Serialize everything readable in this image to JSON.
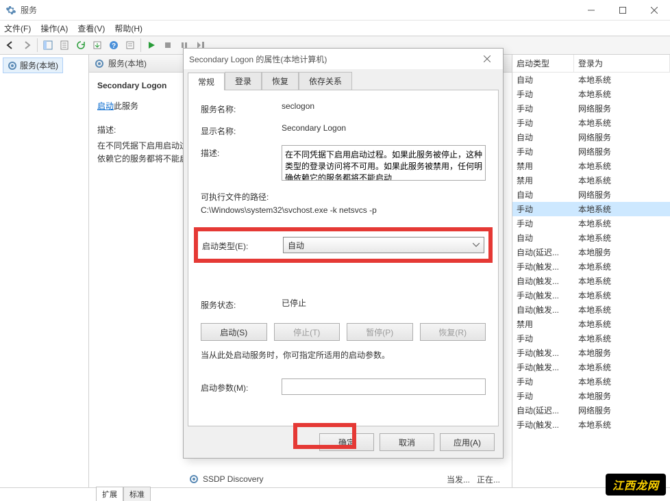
{
  "window": {
    "title": "服务"
  },
  "menu": {
    "file": "文件(F)",
    "action": "操作(A)",
    "view": "查看(V)",
    "help": "帮助(H)"
  },
  "left": {
    "tree_label": "服务(本地)"
  },
  "mid": {
    "header": "服务(本地)",
    "selected_service": "Secondary Logon",
    "start_link": "启动",
    "start_suffix": "此服务",
    "desc_label": "描述:",
    "desc_text": "在不同凭据下启用启动过程。如果此服务被停止，这种类型的登录访问将不可用。如果此服务被禁用，任何明确依赖它的服务都将不能启动"
  },
  "tabs": {
    "ext": "扩展",
    "std": "标准"
  },
  "status": {
    "name": "SSDP Discovery",
    "col3": "当发...",
    "col4": "正在..."
  },
  "cols": {
    "startup": "启动类型",
    "logon": "登录为"
  },
  "rows": [
    {
      "s": "自动",
      "l": "本地系统"
    },
    {
      "s": "手动",
      "l": "本地系统"
    },
    {
      "s": "手动",
      "l": "网络服务"
    },
    {
      "s": "手动",
      "l": "本地系统"
    },
    {
      "s": "自动",
      "l": "网络服务"
    },
    {
      "s": "手动",
      "l": "网络服务"
    },
    {
      "s": "禁用",
      "l": "本地系统"
    },
    {
      "s": "禁用",
      "l": "本地系统"
    },
    {
      "s": "自动",
      "l": "网络服务"
    },
    {
      "s": "手动",
      "l": "本地系统",
      "sel": true
    },
    {
      "s": "手动",
      "l": "本地系统"
    },
    {
      "s": "自动",
      "l": "本地系统"
    },
    {
      "s": "自动(延迟...",
      "l": "本地服务"
    },
    {
      "s": "手动(触发...",
      "l": "本地系统"
    },
    {
      "s": "自动(触发...",
      "l": "本地系统"
    },
    {
      "s": "手动(触发...",
      "l": "本地系统"
    },
    {
      "s": "自动(触发...",
      "l": "本地系统"
    },
    {
      "s": "禁用",
      "l": "本地系统"
    },
    {
      "s": "手动",
      "l": "本地系统"
    },
    {
      "s": "手动(触发...",
      "l": "本地服务"
    },
    {
      "s": "手动(触发...",
      "l": "本地系统"
    },
    {
      "s": "手动",
      "l": "本地系统"
    },
    {
      "s": "手动",
      "l": "本地服务"
    },
    {
      "s": "自动(延迟...",
      "l": "网络服务"
    },
    {
      "s": "手动(触发...",
      "l": "本地系统"
    }
  ],
  "dialog": {
    "title": "Secondary Logon 的属性(本地计算机)",
    "tabs": {
      "general": "常规",
      "logon": "登录",
      "recovery": "恢复",
      "deps": "依存关系"
    },
    "svc_name_label": "服务名称:",
    "svc_name": "seclogon",
    "disp_name_label": "显示名称:",
    "disp_name": "Secondary Logon",
    "desc_label": "描述:",
    "desc": "在不同凭据下启用启动过程。如果此服务被停止，这种类型的登录访问将不可用。如果此服务被禁用，任何明确依赖它的服务都将不能启动",
    "exe_label": "可执行文件的路径:",
    "exe": "C:\\Windows\\system32\\svchost.exe -k netsvcs -p",
    "startup_label": "启动类型(E):",
    "startup_value": "自动",
    "status_label": "服务状态:",
    "status_value": "已停止",
    "btn_start": "启动(S)",
    "btn_stop": "停止(T)",
    "btn_pause": "暂停(P)",
    "btn_resume": "恢复(R)",
    "hint": "当从此处启动服务时，你可指定所适用的启动参数。",
    "params_label": "启动参数(M):",
    "ok": "确定",
    "cancel": "取消",
    "apply": "应用(A)"
  },
  "watermark": "江西龙网"
}
